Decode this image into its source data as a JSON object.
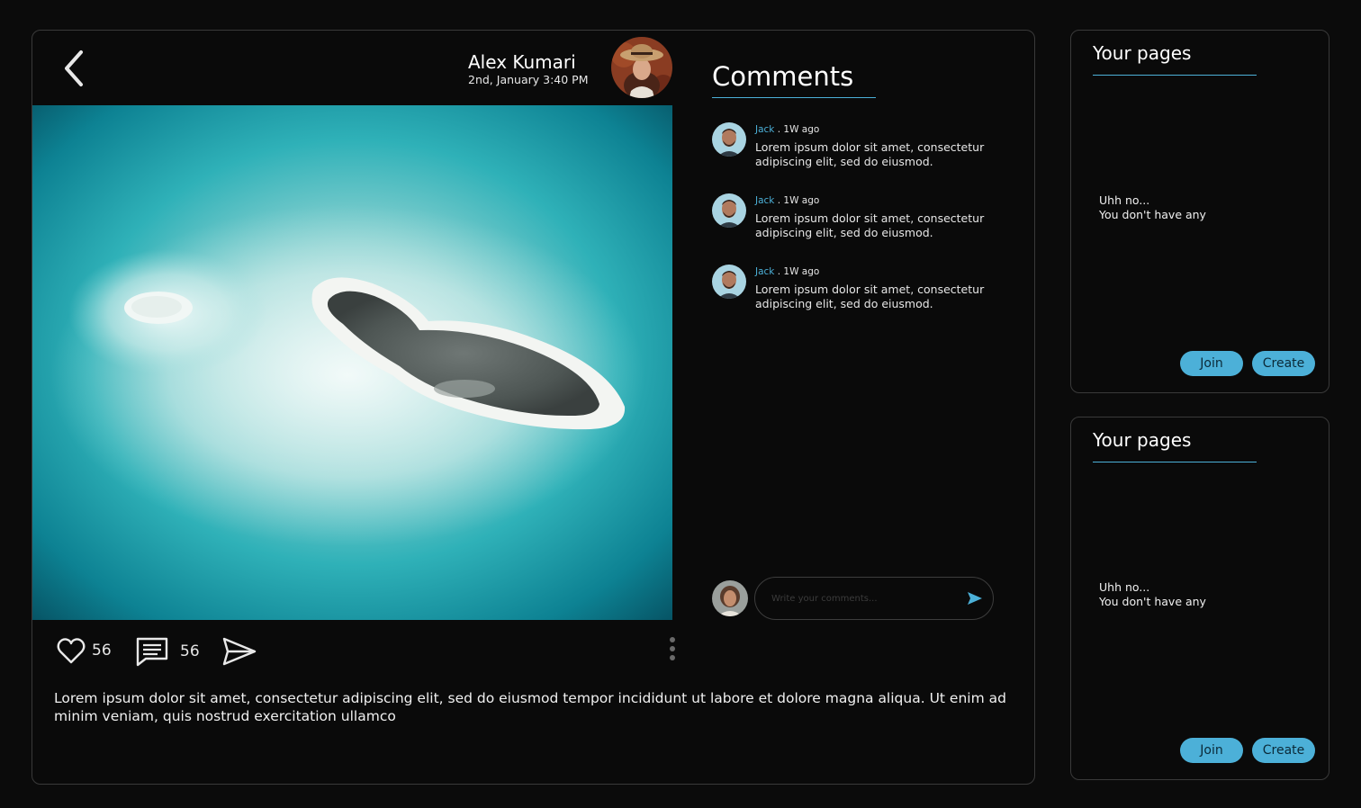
{
  "post": {
    "author": "Alex Kumari",
    "date": "2nd, January 3:40 PM",
    "likes": "56",
    "comments_count": "56",
    "caption": "Lorem ipsum dolor sit amet, consectetur adipiscing elit, sed do eiusmod tempor incididunt ut labore et dolore magna aliqua. Ut enim ad minim veniam, quis nostrud exercitation ullamco"
  },
  "comments": {
    "title": "Comments",
    "items": [
      {
        "author": "Jack",
        "time": " . 1W ago",
        "text": "Lorem ipsum dolor sit amet, consectetur adipiscing elit, sed do eiusmod."
      },
      {
        "author": "Jack",
        "time": " . 1W ago",
        "text": "Lorem ipsum dolor sit amet, consectetur adipiscing elit, sed do eiusmod."
      },
      {
        "author": "Jack",
        "time": " . 1W ago",
        "text": "Lorem ipsum dolor sit amet, consectetur adipiscing elit, sed do eiusmod."
      }
    ],
    "input_placeholder": "Write your comments..."
  },
  "side_panels": [
    {
      "title": "Your pages",
      "empty_line1": "Uhh no...",
      "empty_line2": "You don't have any",
      "join_label": "Join",
      "create_label": "Create"
    },
    {
      "title": "Your pages",
      "empty_line1": "Uhh no...",
      "empty_line2": "You don't have any",
      "join_label": "Join",
      "create_label": "Create"
    }
  ],
  "colors": {
    "accent": "#4cb0d8",
    "background": "#0b0b0b",
    "panel_border": "#3a3a3a"
  },
  "icons": [
    "back-arrow-icon",
    "heart-icon",
    "comment-icon",
    "share-icon",
    "more-vertical-icon",
    "send-icon"
  ]
}
